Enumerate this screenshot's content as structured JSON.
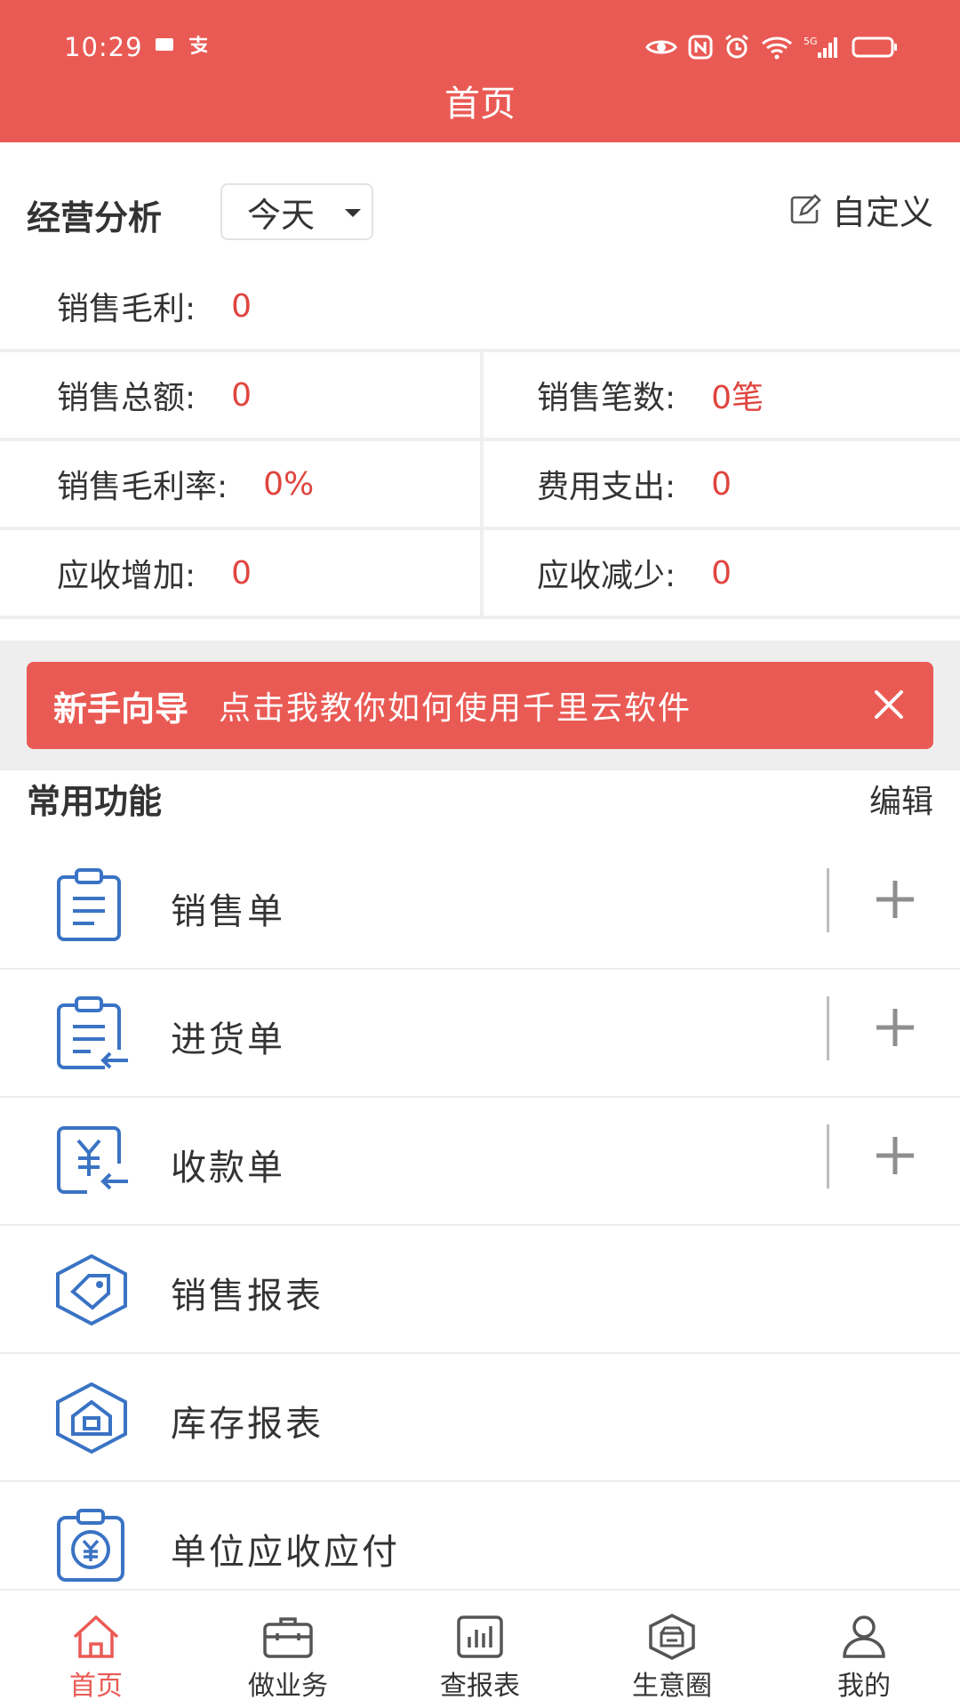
{
  "status_bar": {
    "time": "10:29"
  },
  "header": {
    "title": "首页"
  },
  "analysis": {
    "title": "经营分析",
    "period": "今天",
    "customize_label": "自定义",
    "stats": [
      [
        {
          "label": "销售毛利:",
          "value": "0"
        }
      ],
      [
        {
          "label": "销售总额:",
          "value": "0"
        },
        {
          "label": "销售笔数:",
          "value": "0笔"
        }
      ],
      [
        {
          "label": "销售毛利率:",
          "value": "0%"
        },
        {
          "label": "费用支出:",
          "value": "0"
        }
      ],
      [
        {
          "label": "应收增加:",
          "value": "0"
        },
        {
          "label": "应收减少:",
          "value": "0"
        }
      ]
    ]
  },
  "guide": {
    "title": "新手向导",
    "text": "点击我教你如何使用千里云软件"
  },
  "functions": {
    "title": "常用功能",
    "edit_label": "编辑",
    "items": [
      {
        "label": "销售单",
        "icon": "clipboard-icon"
      },
      {
        "label": "进货单",
        "icon": "clipboard-return-icon"
      },
      {
        "label": "收款单",
        "icon": "yuan-receipt-icon"
      },
      {
        "label": "销售报表",
        "icon": "tag-hexagon-icon"
      },
      {
        "label": "库存报表",
        "icon": "warehouse-hexagon-icon"
      },
      {
        "label": "单位应收应付",
        "icon": "yuan-clipboard-icon"
      }
    ]
  },
  "tabbar": {
    "items": [
      {
        "label": "首页",
        "icon": "home-icon"
      },
      {
        "label": "做业务",
        "icon": "briefcase-icon"
      },
      {
        "label": "查报表",
        "icon": "bar-chart-icon"
      },
      {
        "label": "生意圈",
        "icon": "shop-hexagon-icon"
      },
      {
        "label": "我的",
        "icon": "user-icon"
      }
    ]
  },
  "colors": {
    "primary": "#ea5a54",
    "value_red": "#e0453f",
    "icon_blue": "#3a73c4"
  }
}
